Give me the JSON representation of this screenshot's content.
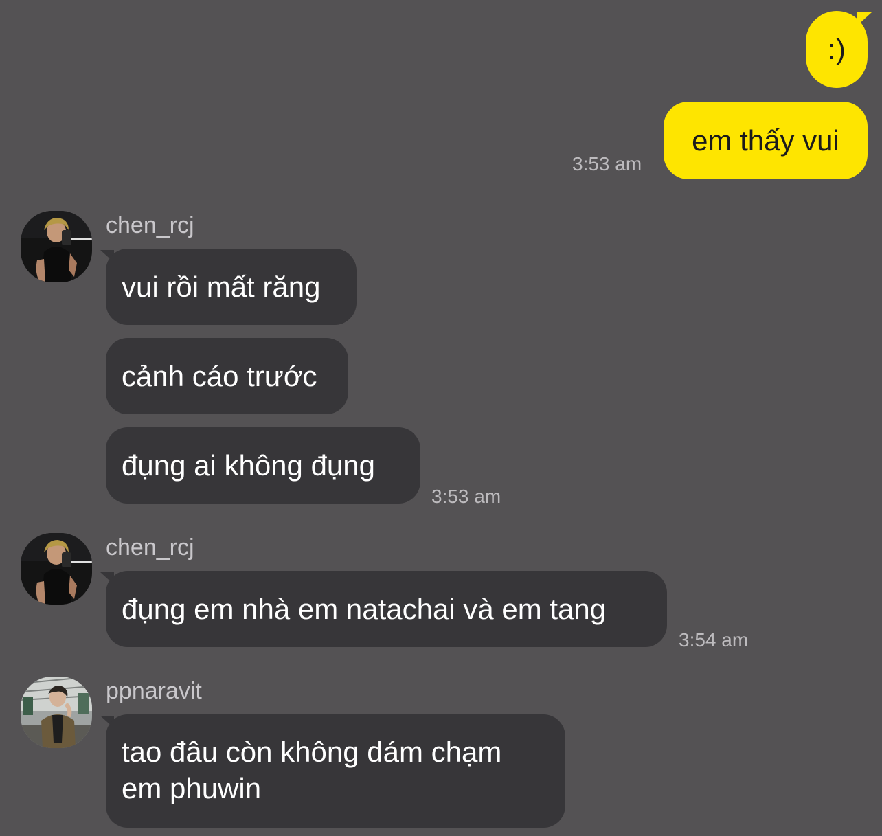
{
  "colors": {
    "background": "#545254",
    "outgoing_bubble": "#fee500",
    "incoming_bubble": "#373639",
    "timestamp": "#bdbbbe",
    "sender_name": "#c9c7cb"
  },
  "messages": {
    "out_1": {
      "text": ":)"
    },
    "out_2": {
      "text": "em thấy vui",
      "time": "3:53 am"
    },
    "group_1": {
      "sender": "chen_rcj",
      "avatar_icon": "profile-photo-icon",
      "texts": [
        "vui rồi mất răng",
        "cảnh cáo trước",
        "đụng ai không đụng"
      ],
      "time": "3:53 am"
    },
    "group_2": {
      "sender": "chen_rcj",
      "avatar_icon": "profile-photo-icon",
      "texts": [
        "đụng em nhà em natachai và em tang"
      ],
      "time": "3:54 am"
    },
    "group_3": {
      "sender": "ppnaravit",
      "avatar_icon": "profile-photo-icon",
      "texts": [
        "tao đâu còn không dám chạm em phuwin"
      ]
    }
  }
}
